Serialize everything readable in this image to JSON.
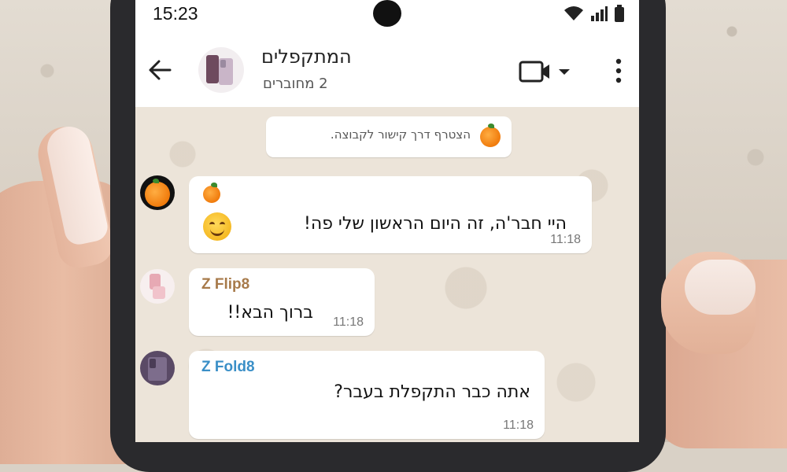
{
  "status_bar": {
    "time": "15:23"
  },
  "header": {
    "group_name": "המתקפלים",
    "members": "2 מחוברים"
  },
  "system_message": {
    "text": "הצטרף דרך קישור לקבוצה."
  },
  "messages": [
    {
      "sender": "",
      "text": "היי חבר'ה, זה היום הראשון שלי פה!",
      "time": "11:18"
    },
    {
      "sender": "Z Flip8",
      "sender_color": "#a77a4a",
      "text": "ברוך הבא!!",
      "time": "11:18"
    },
    {
      "sender": "Z Fold8",
      "sender_color": "#3a8fc7",
      "text": "אתה כבר התקפלת בעבר?",
      "time": "11:18"
    }
  ]
}
